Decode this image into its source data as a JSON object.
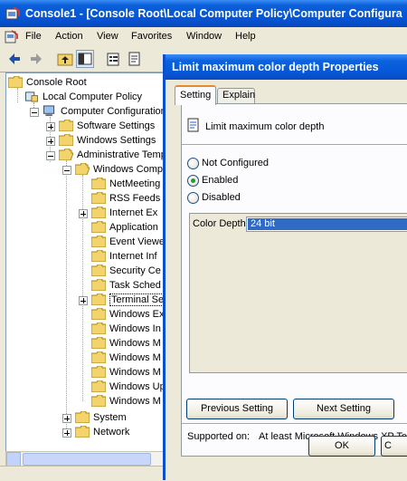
{
  "window": {
    "title": "Console1 - [Console Root\\Local Computer Policy\\Computer Configura"
  },
  "menu": [
    "File",
    "Action",
    "View",
    "Favorites",
    "Window",
    "Help"
  ],
  "tree": {
    "root": "Console Root",
    "local_policy": "Local Computer Policy",
    "computer_config": "Computer Configuration",
    "software_settings": "Software Settings",
    "windows_settings": "Windows Settings",
    "admin_templates": "Administrative Templ",
    "windows_components": "Windows Comp",
    "children": [
      "NetMeeting",
      "RSS Feeds",
      "Internet Ex",
      "Application",
      "Event Viewe",
      "Internet Inf",
      "Security Ce",
      "Task Sched",
      "Terminal Se",
      "Windows Ex",
      "Windows In",
      "Windows M",
      "Windows M",
      "Windows M",
      "Windows Up",
      "Windows M"
    ],
    "system": "System",
    "network": "Network"
  },
  "dialog": {
    "title": "Limit maximum color depth Properties",
    "tabs": [
      "Setting",
      "Explain"
    ],
    "policy_name": "Limit maximum color depth",
    "options": [
      "Not Configured",
      "Enabled",
      "Disabled"
    ],
    "selected_option": "Enabled",
    "color_depth_label": "Color Depth",
    "color_depth_value": "24 bit",
    "supported_label": "Supported on:",
    "supported_value": "At least Microsoft Windows XP Ter",
    "prev_button": "Previous Setting",
    "next_button": "Next Setting",
    "ok_button": "OK",
    "cancel_button": "C"
  }
}
